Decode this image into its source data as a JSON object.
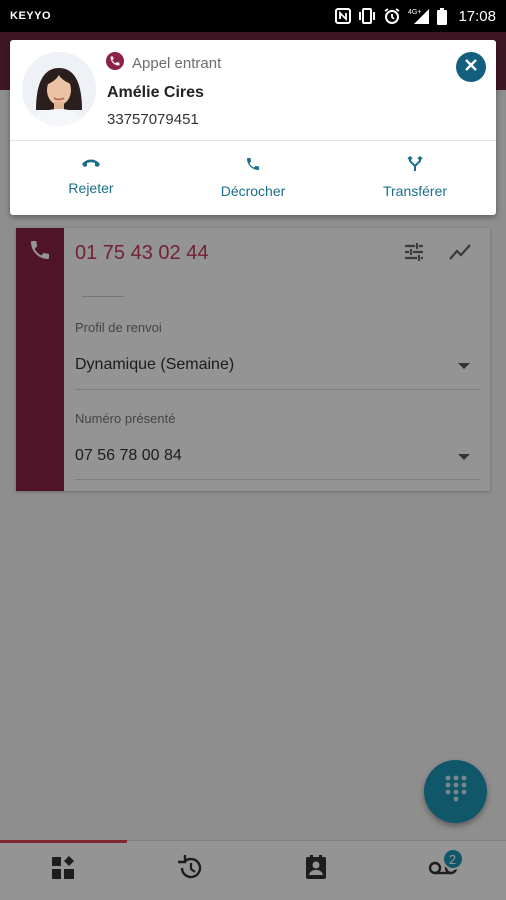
{
  "status_bar": {
    "carrier": "KEYYO",
    "network": "4G+",
    "time": "17:08",
    "icons": [
      "nfc-icon",
      "vibrate-icon",
      "alarm-icon",
      "signal-icon",
      "battery-icon"
    ]
  },
  "notification": {
    "app_label": "Appel entrant",
    "caller_name": "Amélie Cires",
    "caller_number": "33757079451",
    "actions": [
      {
        "label": "Rejeter",
        "icon": "hang-up-icon"
      },
      {
        "label": "Décrocher",
        "icon": "phone-icon"
      },
      {
        "label": "Transférer",
        "icon": "transfer-icon"
      }
    ],
    "close_icon": "close-icon"
  },
  "line_card": {
    "number": "01 75 43 02 44",
    "profile_label": "Profil de renvoi",
    "profile_value": "Dynamique (Semaine)",
    "presented_label": "Numéro présenté",
    "presented_value": "07 56 78 00 84"
  },
  "bottom_nav": {
    "items": [
      {
        "icon": "dashboard-icon",
        "active": true
      },
      {
        "icon": "history-icon"
      },
      {
        "icon": "contacts-icon"
      },
      {
        "icon": "voicemail-icon",
        "badge": "2"
      }
    ]
  },
  "colors": {
    "brand": "#8b2346",
    "accent": "#1c96b5",
    "action_text": "#1b6e89",
    "number_text": "#c33b5b",
    "active_tab": "#d9414f"
  }
}
